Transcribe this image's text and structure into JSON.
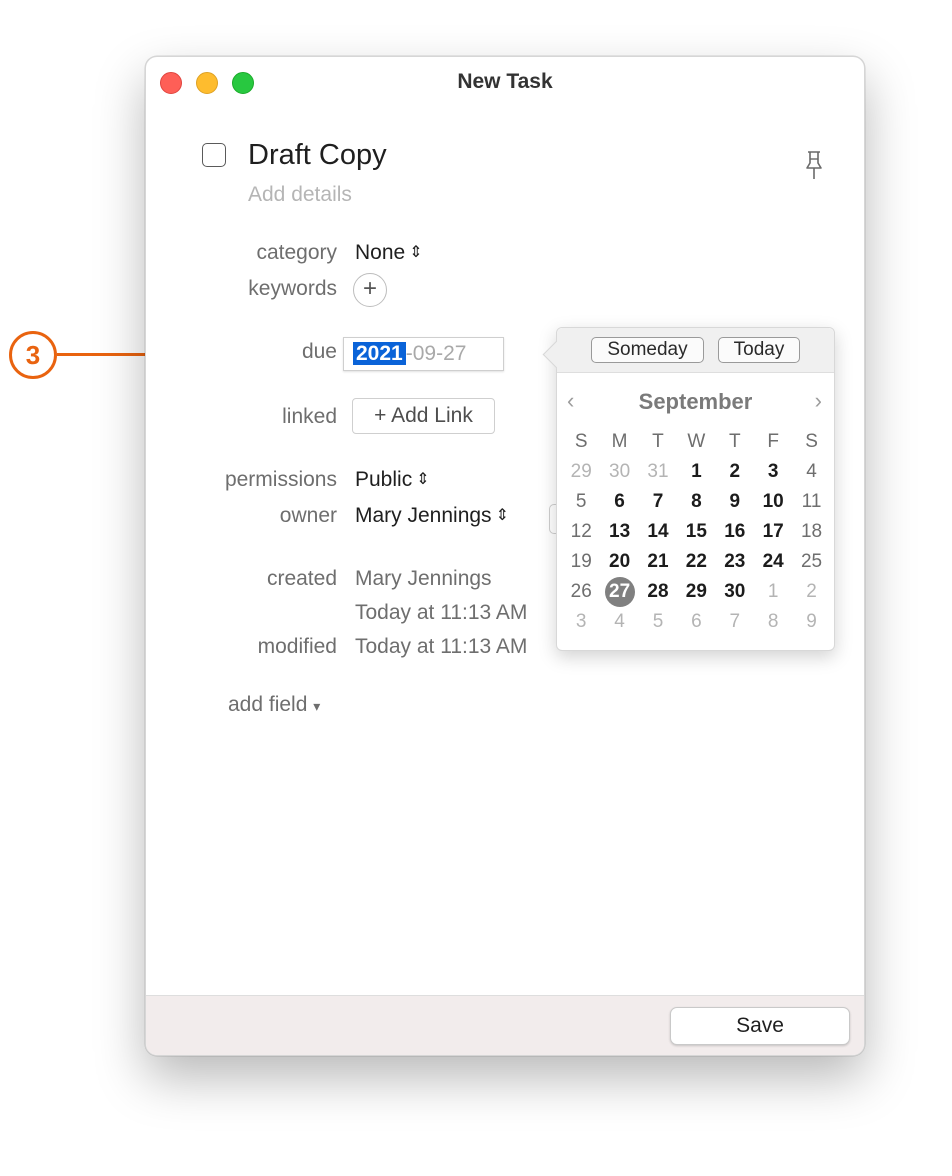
{
  "window": {
    "title": "New Task"
  },
  "task": {
    "title": "Draft Copy",
    "details_placeholder": "Add details"
  },
  "fields": {
    "category": {
      "label": "category",
      "value": "None"
    },
    "keywords": {
      "label": "keywords",
      "add": "+"
    },
    "due": {
      "label": "due",
      "year": "2021",
      "rest": "-09-27"
    },
    "linked": {
      "label": "linked",
      "button": "+ Add Link"
    },
    "permissions": {
      "label": "permissions",
      "value": "Public"
    },
    "owner": {
      "label": "owner",
      "value": "Mary Jennings"
    },
    "created": {
      "label": "created",
      "by": "Mary Jennings",
      "time": "Today at 11:13 AM"
    },
    "modified": {
      "label": "modified",
      "time": "Today at 11:13 AM"
    },
    "add_field": "add field"
  },
  "icons": {
    "updown": "⌃⌄",
    "dropdown": "▾",
    "pin": "pin-icon",
    "prev": "‹",
    "next": "›"
  },
  "popover": {
    "someday": "Someday",
    "today": "Today",
    "month": "September",
    "weekdays": [
      "S",
      "M",
      "T",
      "W",
      "T",
      "F",
      "S"
    ],
    "weeks": [
      [
        "29",
        "30",
        "31",
        "1",
        "2",
        "3",
        "4"
      ],
      [
        "5",
        "6",
        "7",
        "8",
        "9",
        "10",
        "11"
      ],
      [
        "12",
        "13",
        "14",
        "15",
        "16",
        "17",
        "18"
      ],
      [
        "19",
        "20",
        "21",
        "22",
        "23",
        "24",
        "25"
      ],
      [
        "26",
        "27",
        "28",
        "29",
        "30",
        "1",
        "2"
      ],
      [
        "3",
        "4",
        "5",
        "6",
        "7",
        "8",
        "9"
      ]
    ],
    "selected": "27"
  },
  "footer": {
    "save": "Save"
  },
  "annotation": {
    "number": "3"
  },
  "colors": {
    "accent": "#e9630f",
    "selection": "#0a63d8"
  }
}
